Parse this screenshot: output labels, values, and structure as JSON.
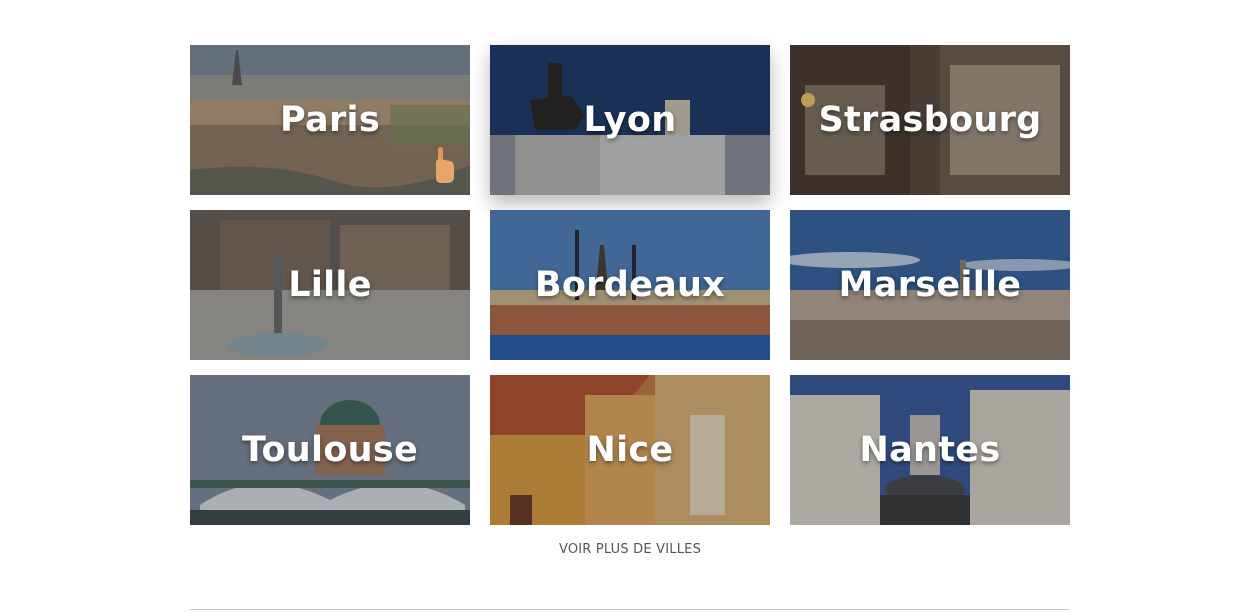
{
  "cities": [
    {
      "name": "Paris"
    },
    {
      "name": "Lyon"
    },
    {
      "name": "Strasbourg"
    },
    {
      "name": "Lille"
    },
    {
      "name": "Bordeaux"
    },
    {
      "name": "Marseille"
    },
    {
      "name": "Toulouse"
    },
    {
      "name": "Nice"
    },
    {
      "name": "Nantes"
    }
  ],
  "more_link": "VOIR PLUS DE VILLES"
}
